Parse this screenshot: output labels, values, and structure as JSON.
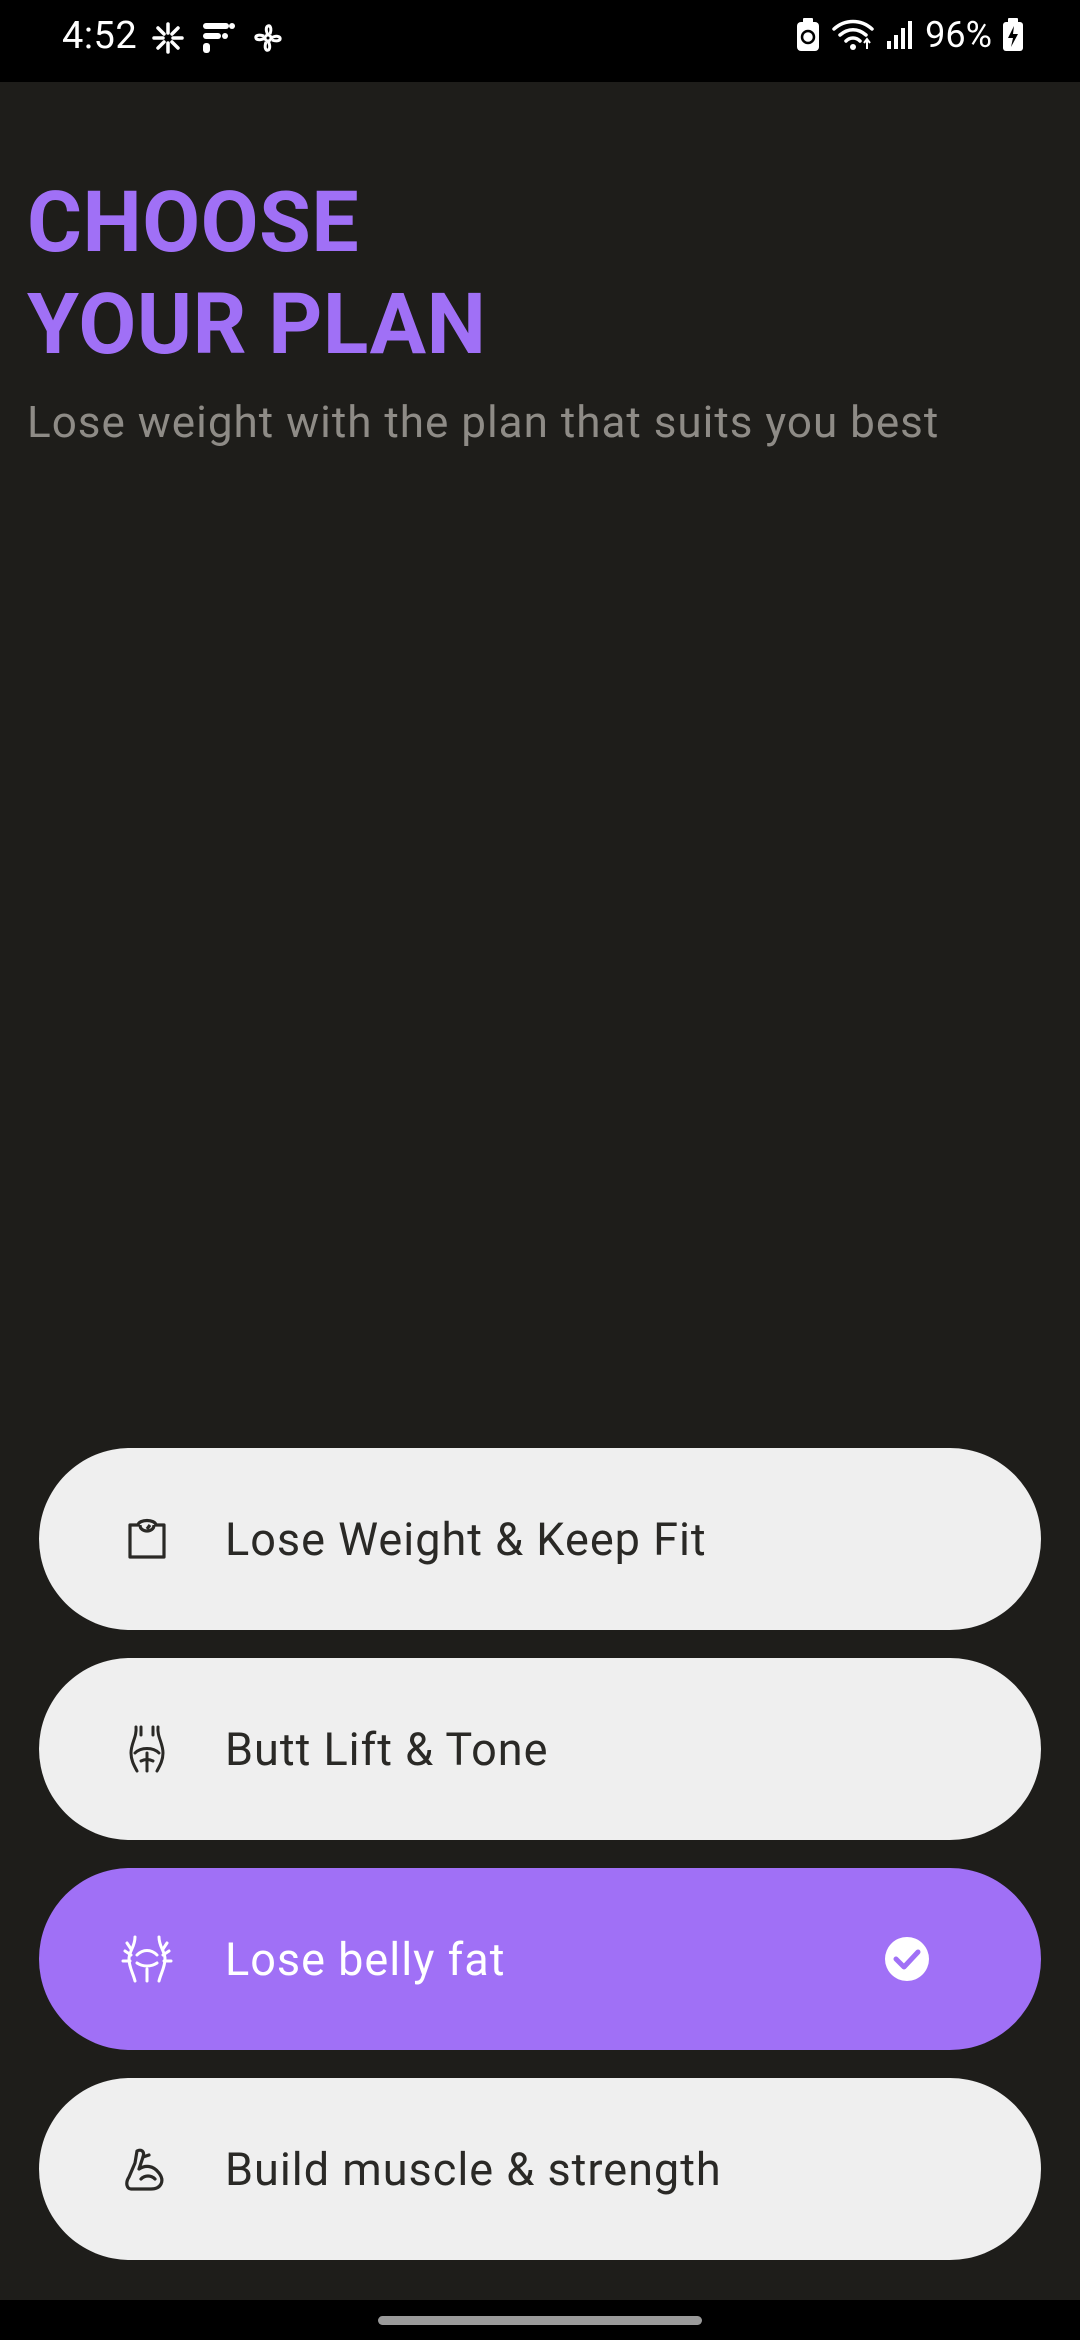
{
  "status_bar": {
    "time": "4:52",
    "battery": "96%",
    "left_icons": [
      "pinwheel-icon",
      "fitness-app-icon",
      "fan-icon"
    ],
    "right_icons": [
      "recycle-battery-icon",
      "wifi-icon",
      "signal-icon",
      "battery-charging-icon"
    ]
  },
  "header": {
    "title_line1": "CHOOSE",
    "title_line2": "YOUR PLAN",
    "subtitle": "Lose weight with the plan that suits you best"
  },
  "plans": [
    {
      "label": "Lose Weight & Keep Fit",
      "icon": "scale-icon",
      "selected": false
    },
    {
      "label": "Butt Lift & Tone",
      "icon": "hips-icon",
      "selected": false
    },
    {
      "label": "Lose belly fat",
      "icon": "belly-icon",
      "selected": true
    },
    {
      "label": "Build muscle & strength",
      "icon": "muscle-arm-icon",
      "selected": false
    }
  ],
  "colors": {
    "accent": "#a070f6",
    "background": "#1e1d1a",
    "option_bg": "#efefef",
    "subtitle": "#8e8b86"
  }
}
